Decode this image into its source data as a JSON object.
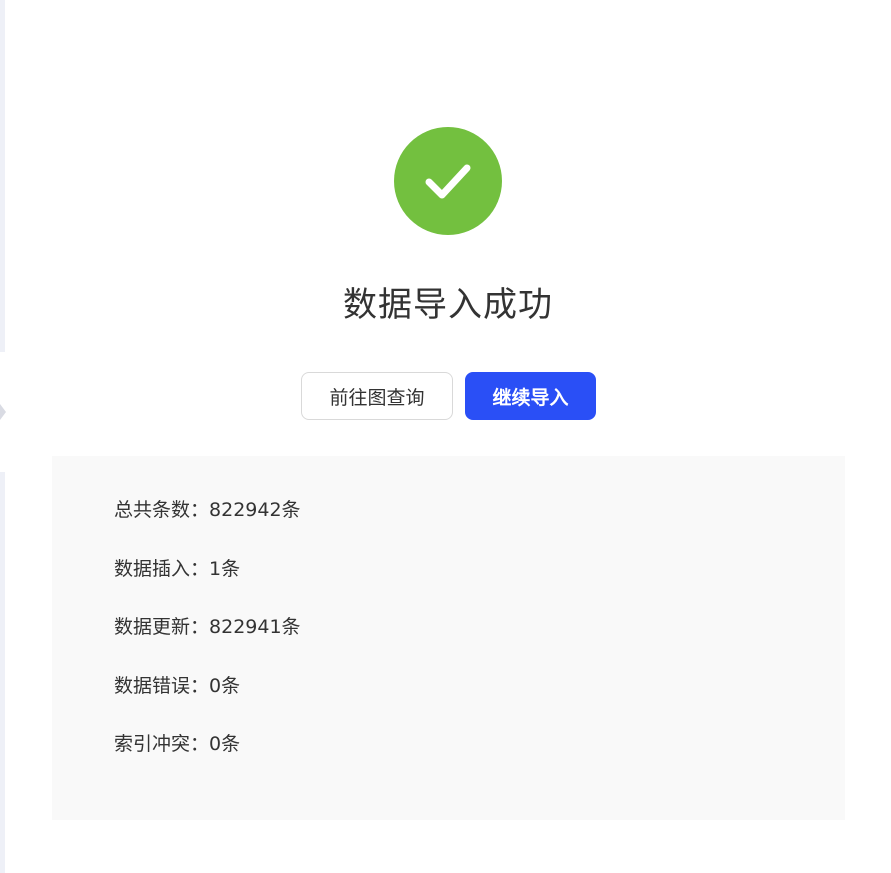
{
  "result": {
    "status_icon": "check-icon",
    "status_color": "#73c03f",
    "title": "数据导入成功"
  },
  "actions": {
    "go_to_graph_label": "前往图查询",
    "continue_import_label": "继续导入",
    "primary_color": "#2a4ff6"
  },
  "stats": [
    {
      "label": "总共条数：",
      "value": "822942条"
    },
    {
      "label": "数据插入：",
      "value": "1条"
    },
    {
      "label": "数据更新：",
      "value": "822941条"
    },
    {
      "label": "数据错误：",
      "value": "0条"
    },
    {
      "label": "索引冲突：",
      "value": "0条"
    }
  ]
}
